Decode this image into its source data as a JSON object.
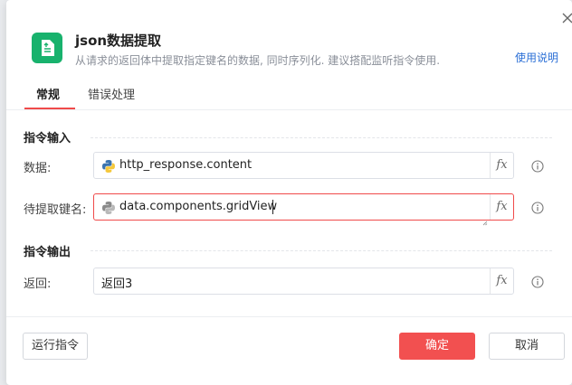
{
  "dialog": {
    "title": "json数据提取",
    "subtitle": "从请求的返回体中提取指定键名的数据, 同时序列化. 建议搭配监听指令使用.",
    "help_link": "使用说明",
    "close_icon": "close-icon",
    "app_icon": "document-icon",
    "accent_color": "#f04a4a",
    "app_icon_color": "#18b26d"
  },
  "tabs": [
    {
      "label": "常规",
      "active": true
    },
    {
      "label": "错误处理",
      "active": false
    }
  ],
  "sections": {
    "input_title": "指令输入",
    "output_title": "指令输出"
  },
  "fields": {
    "data": {
      "label": "数据:",
      "value": "http_response.content",
      "icon": "python-icon",
      "fx": "fx"
    },
    "key": {
      "label": "待提取键名:",
      "value": "data.components.gridView",
      "icon": "python-icon",
      "fx": "fx",
      "focused": true
    },
    "return": {
      "label": "返回:",
      "value": "返回3",
      "fx": "fx"
    }
  },
  "footer": {
    "run_label": "运行指令",
    "confirm_label": "确定",
    "cancel_label": "取消"
  }
}
